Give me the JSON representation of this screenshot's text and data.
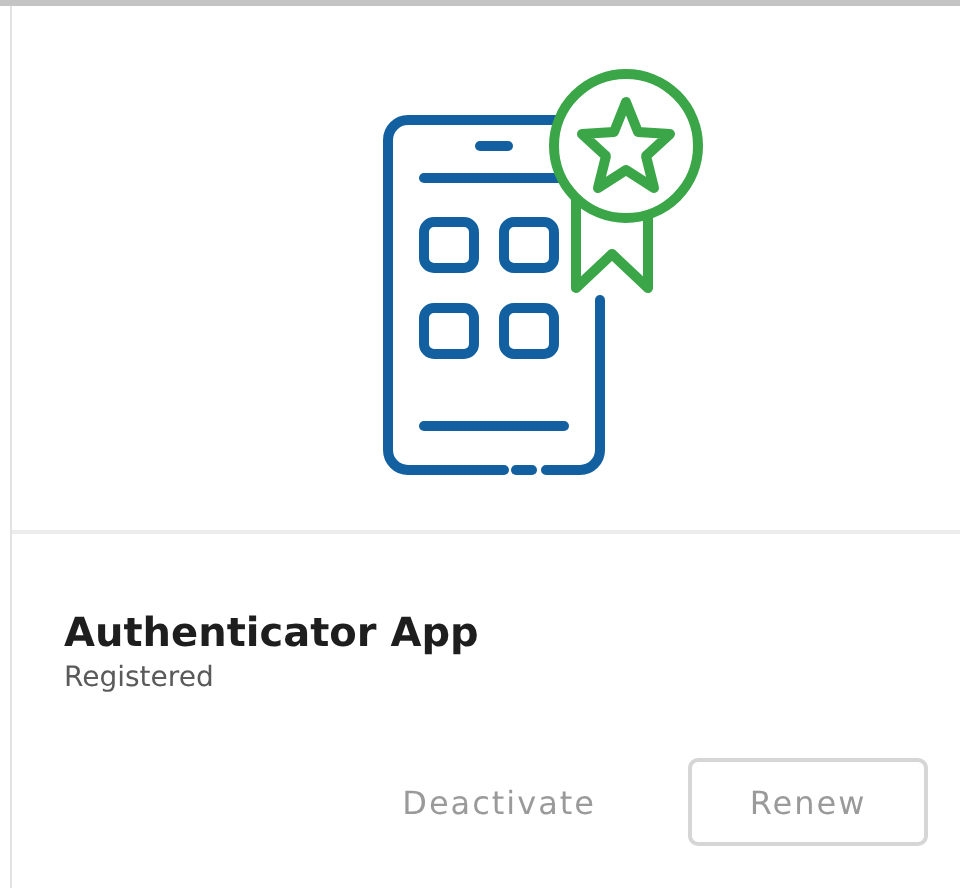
{
  "card": {
    "title": "Authenticator App",
    "status": "Registered",
    "actions": [
      {
        "label": "Deactivate",
        "kind": "link",
        "disabled": true
      },
      {
        "label": "Renew",
        "kind": "outline",
        "disabled": true
      }
    ]
  }
}
